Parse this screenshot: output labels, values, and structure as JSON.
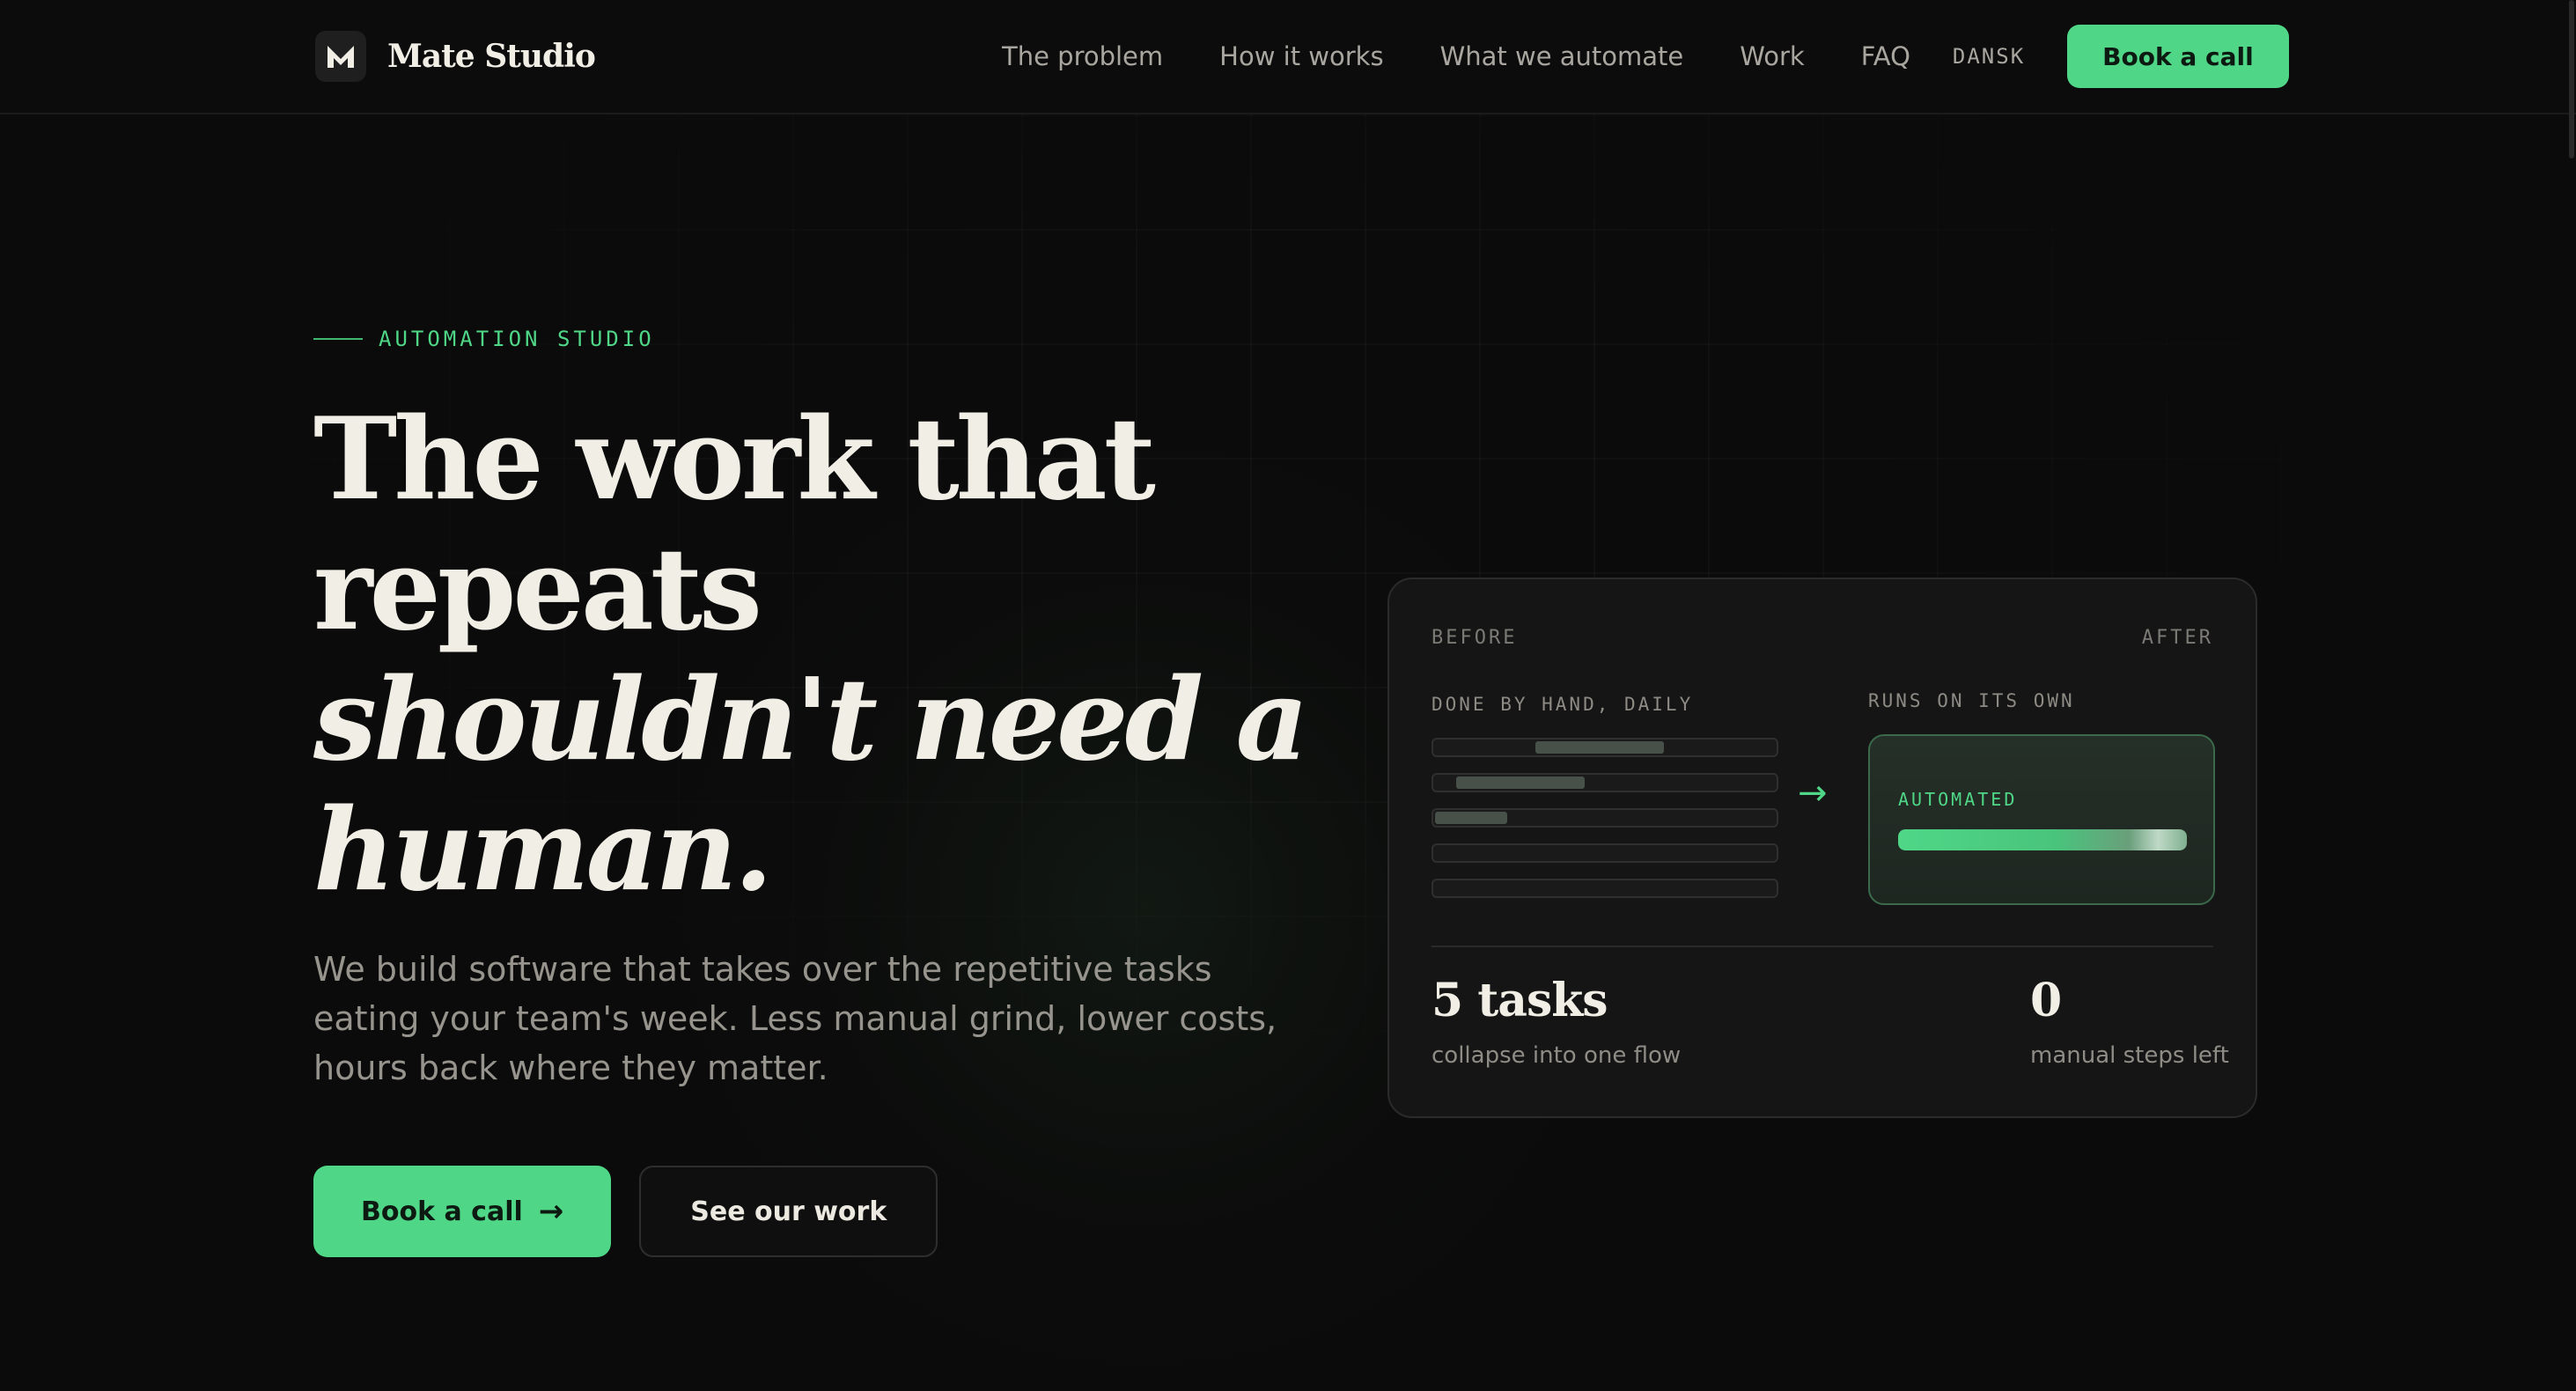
{
  "header": {
    "brand_mark": "M",
    "brand_name": "Mate Studio",
    "nav": [
      {
        "label": "The problem"
      },
      {
        "label": "How it works"
      },
      {
        "label": "What we automate"
      },
      {
        "label": "Work"
      },
      {
        "label": "FAQ"
      }
    ],
    "language_toggle": "DANSK",
    "cta_label": "Book a call"
  },
  "hero": {
    "eyebrow": "AUTOMATION STUDIO",
    "headline_lines": [
      "The work that",
      "repeats"
    ],
    "headline_italic_lines": [
      "shouldn't need a",
      "human."
    ],
    "subcopy": "We build software that takes over the repetitive tasks eating your team's week. Less manual grind, lower costs, hours back where they matter.",
    "primary_cta": "Book a call",
    "primary_cta_arrow": "→",
    "secondary_cta": "See our work"
  },
  "card": {
    "before_label": "BEFORE",
    "after_label": "AFTER",
    "manual_label": "DONE BY HAND, DAILY",
    "auto_label": "RUNS ON ITS OWN",
    "flow_arrow": "→",
    "automated_label": "AUTOMATED",
    "manual_tasks_count": 5,
    "automated_progress": 1.0,
    "stats": [
      {
        "value": "5 tasks",
        "caption": "collapse into one flow"
      },
      {
        "value": "0",
        "caption": "manual steps left"
      }
    ]
  },
  "colors": {
    "accent": "#4fd787",
    "background": "#0b0b0b",
    "card": "#151515",
    "text_primary": "#f1eee6",
    "text_muted": "#97948d"
  }
}
